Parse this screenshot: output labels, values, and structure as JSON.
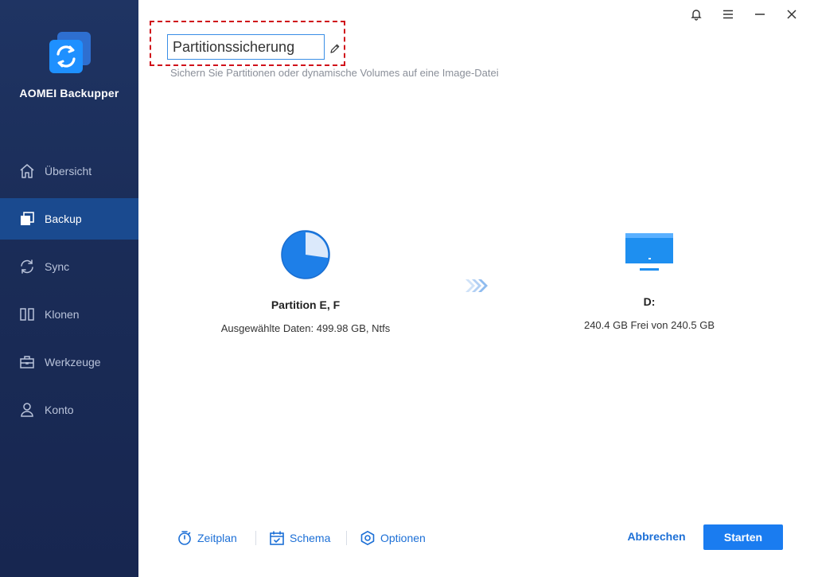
{
  "app": {
    "name": "AOMEI Backupper"
  },
  "sidebar": {
    "items": [
      {
        "label": "Übersicht",
        "icon": "home-icon"
      },
      {
        "label": "Backup",
        "icon": "backup-icon",
        "active": true
      },
      {
        "label": "Sync",
        "icon": "sync-icon"
      },
      {
        "label": "Klonen",
        "icon": "clone-icon"
      },
      {
        "label": "Werkzeuge",
        "icon": "toolbox-icon"
      },
      {
        "label": "Konto",
        "icon": "user-icon"
      }
    ]
  },
  "window_controls": [
    "bell-icon",
    "menu-icon",
    "minimize-icon",
    "close-icon"
  ],
  "task": {
    "name": "Partitionssicherung",
    "description": "Sichern Sie Partitionen oder dynamische Volumes auf eine Image-Datei"
  },
  "source": {
    "title": "Partition E, F",
    "detail": "Ausgewählte Daten: 499.98 GB, Ntfs"
  },
  "destination": {
    "title": "D:",
    "detail": "240.4 GB Frei von 240.5 GB"
  },
  "footer": {
    "schedule_label": "Zeitplan",
    "scheme_label": "Schema",
    "options_label": "Optionen",
    "cancel_label": "Abbrechen",
    "start_label": "Starten"
  },
  "colors": {
    "sidebar_bg": "#1f3463",
    "sidebar_active": "#1a4a8f",
    "accent": "#1a7cf0",
    "highlight_border": "#d0101a"
  }
}
